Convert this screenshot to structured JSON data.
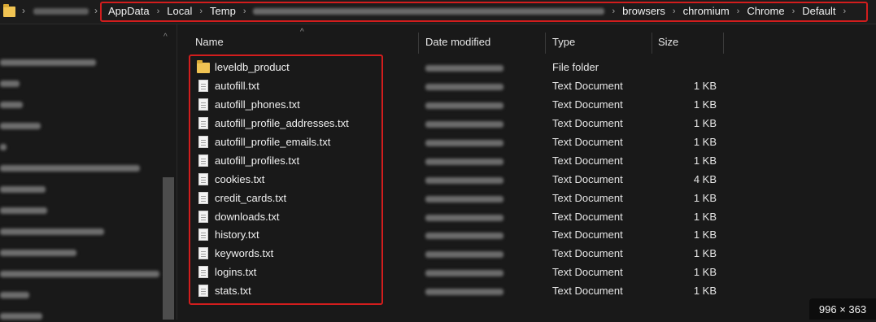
{
  "address_bar": {
    "crumbs": [
      "AppData",
      "Local",
      "Temp",
      "browsers",
      "chromium",
      "Chrome",
      "Default"
    ]
  },
  "columns": {
    "name": "Name",
    "date_modified": "Date modified",
    "type": "Type",
    "size": "Size"
  },
  "files": [
    {
      "name": "leveldb_product",
      "type": "File folder",
      "size": "",
      "icon": "folder-icon"
    },
    {
      "name": "autofill.txt",
      "type": "Text Document",
      "size": "1 KB",
      "icon": "text-document-icon"
    },
    {
      "name": "autofill_phones.txt",
      "type": "Text Document",
      "size": "1 KB",
      "icon": "text-document-icon"
    },
    {
      "name": "autofill_profile_addresses.txt",
      "type": "Text Document",
      "size": "1 KB",
      "icon": "text-document-icon"
    },
    {
      "name": "autofill_profile_emails.txt",
      "type": "Text Document",
      "size": "1 KB",
      "icon": "text-document-icon"
    },
    {
      "name": "autofill_profiles.txt",
      "type": "Text Document",
      "size": "1 KB",
      "icon": "text-document-icon"
    },
    {
      "name": "cookies.txt",
      "type": "Text Document",
      "size": "4 KB",
      "icon": "text-document-icon"
    },
    {
      "name": "credit_cards.txt",
      "type": "Text Document",
      "size": "1 KB",
      "icon": "text-document-icon"
    },
    {
      "name": "downloads.txt",
      "type": "Text Document",
      "size": "1 KB",
      "icon": "text-document-icon"
    },
    {
      "name": "history.txt",
      "type": "Text Document",
      "size": "1 KB",
      "icon": "text-document-icon"
    },
    {
      "name": "keywords.txt",
      "type": "Text Document",
      "size": "1 KB",
      "icon": "text-document-icon"
    },
    {
      "name": "logins.txt",
      "type": "Text Document",
      "size": "1 KB",
      "icon": "text-document-icon"
    },
    {
      "name": "stats.txt",
      "type": "Text Document",
      "size": "1 KB",
      "icon": "text-document-icon"
    }
  ],
  "image_size_badge": "996 × 363",
  "colors": {
    "background": "#191919",
    "highlight_border": "#d21d1d",
    "folder": "#f1c453"
  }
}
